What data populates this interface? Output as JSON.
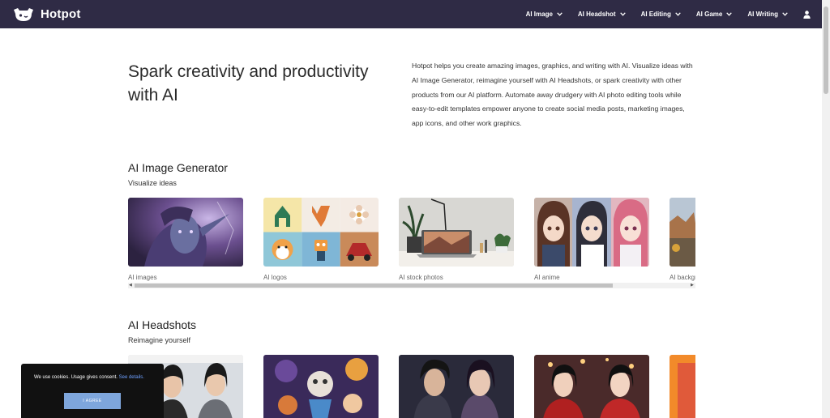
{
  "header": {
    "brand": "Hotpot",
    "nav": [
      {
        "label": "AI Image"
      },
      {
        "label": "AI Headshot"
      },
      {
        "label": "AI Editing"
      },
      {
        "label": "AI Game"
      },
      {
        "label": "AI Writing"
      }
    ]
  },
  "hero": {
    "title": "Spark creativity and productivity with AI",
    "description": "Hotpot helps you create amazing images, graphics, and writing with AI. Visualize ideas with AI Image Generator, reimagine yourself with AI Headshots, or spark creativity with other products from our AI platform. Automate away drudgery with AI photo editing tools while easy-to-edit templates empower anyone to create social media posts, marketing images, app icons, and other work graphics."
  },
  "sections": [
    {
      "title": "AI Image Generator",
      "subtitle": "Visualize ideas",
      "cards": [
        {
          "label": "AI images"
        },
        {
          "label": "AI logos"
        },
        {
          "label": "AI stock photos"
        },
        {
          "label": "AI anime"
        },
        {
          "label": "AI backgrounds"
        }
      ]
    },
    {
      "title": "AI Headshots",
      "subtitle": "Reimagine yourself"
    }
  ],
  "cookie": {
    "text": "We use cookies. Usage gives consent.",
    "link": "See details.",
    "button": "I AGREE"
  },
  "colors": {
    "header_bg": "#2f2b45",
    "cookie_bg": "#111111",
    "cookie_button": "#7ea6dc",
    "link": "#6ea0ff"
  }
}
